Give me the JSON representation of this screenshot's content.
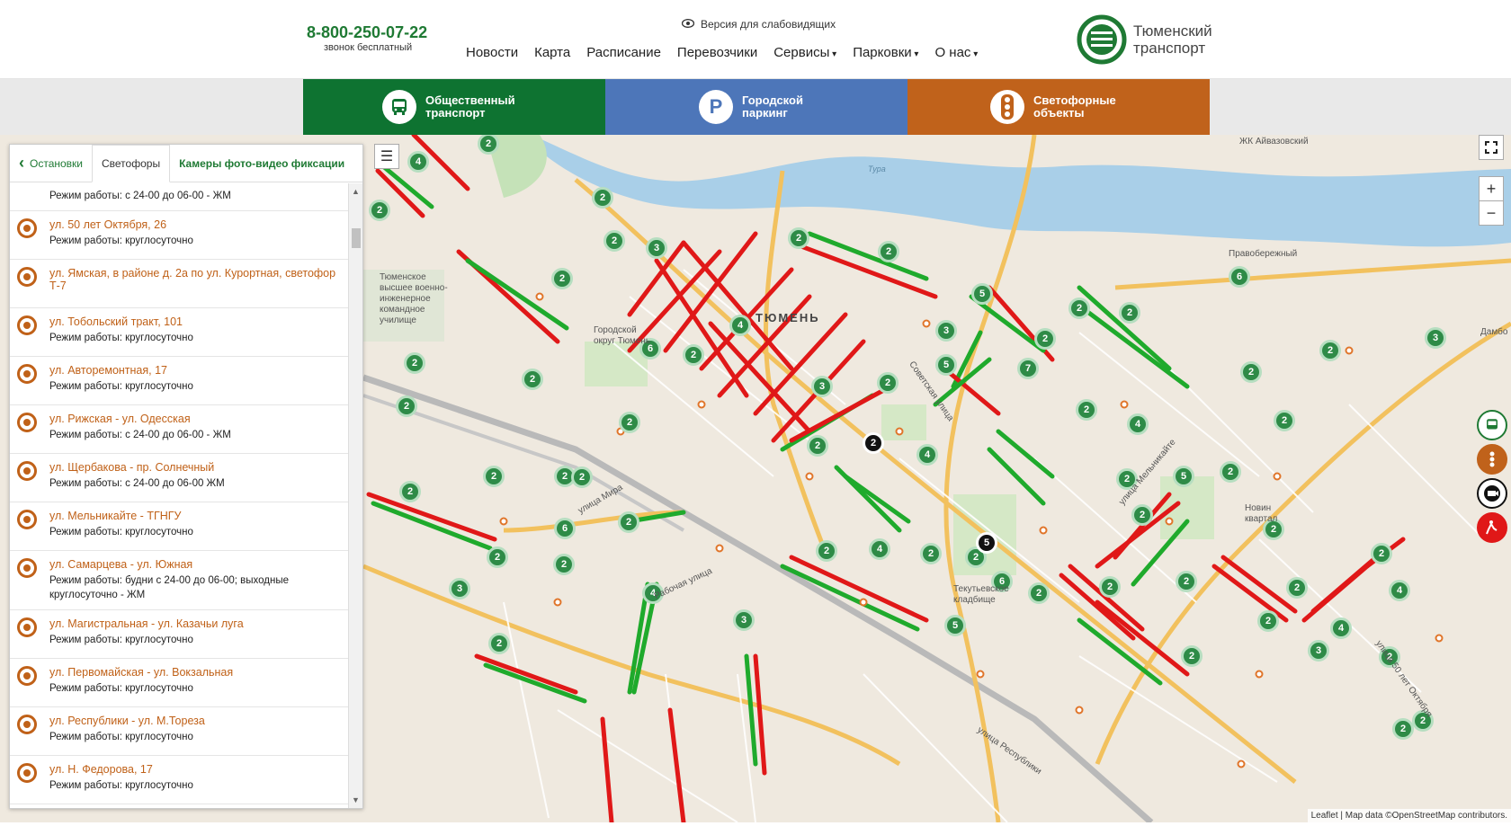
{
  "header": {
    "phone": "8-800-250-07-22",
    "phone_note": "звонок бесплатный",
    "accessibility": "Версия для слабовидящих",
    "nav": [
      {
        "label": "Новости",
        "dropdown": false
      },
      {
        "label": "Карта",
        "dropdown": false
      },
      {
        "label": "Расписание",
        "dropdown": false
      },
      {
        "label": "Перевозчики",
        "dropdown": false
      },
      {
        "label": "Сервисы",
        "dropdown": true
      },
      {
        "label": "Парковки",
        "dropdown": true
      },
      {
        "label": "О нас",
        "dropdown": true
      }
    ],
    "logo_line1": "Тюменский",
    "logo_line2": "транспорт",
    "logo_color": "#1f7a34"
  },
  "bands": [
    {
      "line1": "Общественный",
      "line2": "транспорт",
      "color": "#0e7331",
      "icon": "bus-icon"
    },
    {
      "line1": "Городской",
      "line2": "паркинг",
      "color": "#4d76b9",
      "icon": "parking-icon"
    },
    {
      "line1": "Светофорные",
      "line2": "объекты",
      "color": "#c0621b",
      "icon": "traffic-light-icon"
    }
  ],
  "panel": {
    "tabs": [
      "Остановки",
      "Светофоры",
      "Камеры фото-видео фиксации"
    ],
    "active_tab": "Светофоры",
    "top_row_mode": "Режим работы: с 24-00 до 06-00 - ЖМ",
    "items": [
      {
        "name": "ул. 50 лет Октября, 26",
        "mode": "Режим работы: круглосуточно"
      },
      {
        "name": "ул. Ямская, в районе д. 2а по ул. Курортная, светофор Т-7",
        "mode": ""
      },
      {
        "name": "ул. Тобольский тракт, 101",
        "mode": "Режим работы: круглосуточно"
      },
      {
        "name": "ул. Авторемонтная, 17",
        "mode": "Режим работы: круглосуточно"
      },
      {
        "name": "ул. Рижская - ул. Одесская",
        "mode": "Режим работы: с 24-00 до 06-00 - ЖМ"
      },
      {
        "name": "ул. Щербакова - пр. Солнечный",
        "mode": "Режим работы: с 24-00 до 06-00 ЖМ"
      },
      {
        "name": "ул. Мельникайте - ТГНГУ",
        "mode": "Режим работы: круглосуточно"
      },
      {
        "name": "ул. Самарцева - ул. Южная",
        "mode": "Режим работы: будни с 24-00 до 06-00; выходные круглосуточно - ЖМ"
      },
      {
        "name": "ул. Магистральная - ул. Казачьи луга",
        "mode": "Режим работы: круглосуточно"
      },
      {
        "name": "ул. Первомайская - ул. Вокзальная",
        "mode": "Режим работы: круглосуточно"
      },
      {
        "name": "ул. Республики - ул. М.Тореза",
        "mode": "Режим работы: круглосуточно"
      },
      {
        "name": "ул. Н. Федорова, 17",
        "mode": "Режим работы: круглосуточно"
      }
    ]
  },
  "map": {
    "city_label": "ТЮМЕНЬ",
    "labels": [
      "ЖК Айвазовский",
      "Тура",
      "Правобережный",
      "Тюменское высшее военно-инженерное командное училище",
      "Городской округ Тюмень",
      "Текутьевское кладбище",
      "Новин квартал",
      "Дамбо",
      "улица Мира",
      "Рабочая улица",
      "улица Мельникайте",
      "улица 50 лет Октября",
      "улица Республики",
      "Советская улица"
    ],
    "cluster_counts": [
      "2",
      "4",
      "2",
      "2",
      "2",
      "3",
      "2",
      "2",
      "6",
      "2",
      "2",
      "5",
      "2",
      "3",
      "2",
      "4",
      "2",
      "3",
      "2",
      "7",
      "2",
      "2",
      "5",
      "4",
      "2",
      "2",
      "5",
      "2",
      "2",
      "6",
      "2",
      "2",
      "2",
      "2",
      "2",
      "2",
      "4",
      "2",
      "2",
      "6",
      "2",
      "2",
      "2",
      "2",
      "3",
      "2",
      "4",
      "3",
      "2",
      "4",
      "2",
      "6",
      "2",
      "2",
      "2",
      "5",
      "2",
      "2",
      "2",
      "4",
      "3",
      "2",
      "2",
      "2",
      "4",
      "2",
      "2",
      "2",
      "3",
      "2"
    ],
    "dark_counts": [
      "2",
      "5"
    ],
    "zoom_in": "+",
    "zoom_out": "−",
    "attribution": "Leaflet | Map data ©OpenStreetMap contributors.",
    "side_icons": [
      "bus-layer-icon",
      "traffic-light-layer-icon",
      "camera-layer-icon",
      "roadworks-layer-icon"
    ],
    "colors": {
      "green": "#1faa2c",
      "red": "#e01818",
      "cluster": "#2e8b47",
      "river": "#a9cfe8"
    }
  }
}
